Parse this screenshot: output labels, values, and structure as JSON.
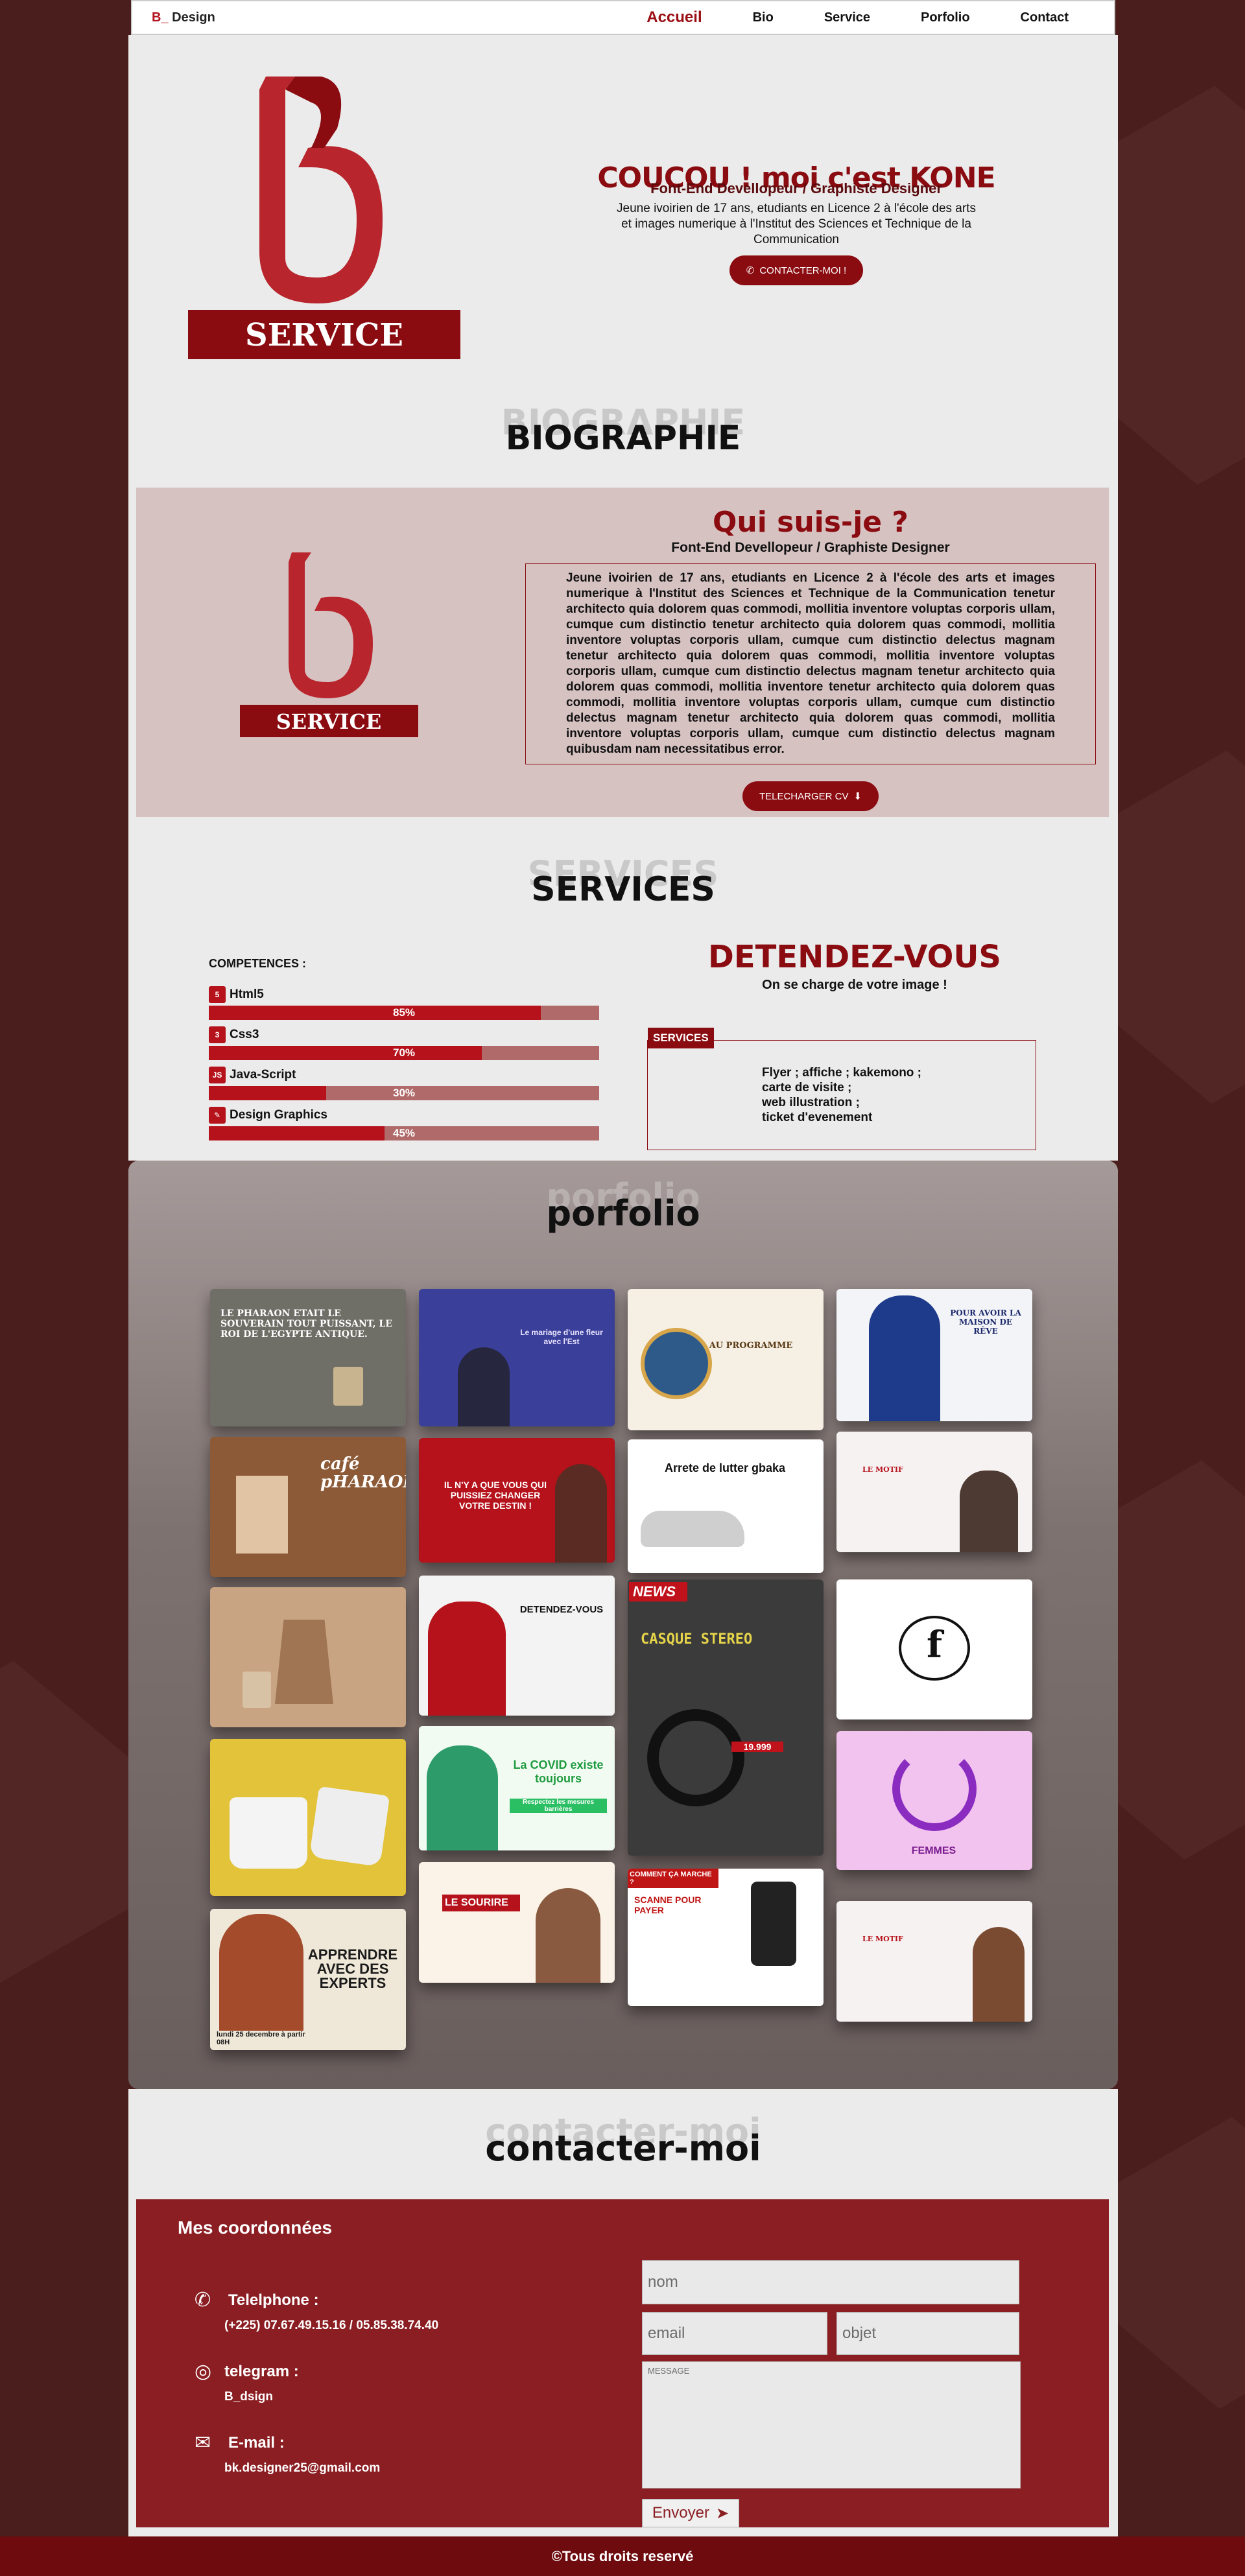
{
  "nav": {
    "brand_mark": "B_",
    "brand_text": "Design",
    "items": [
      {
        "label": "Accueil",
        "active": true
      },
      {
        "label": "Bio",
        "active": false
      },
      {
        "label": "Service",
        "active": false
      },
      {
        "label": "Porfolio",
        "active": false
      },
      {
        "label": "Contact",
        "active": false
      }
    ]
  },
  "hero": {
    "logo_letter": "B",
    "logo_word": "SERVICE",
    "title": "COUCOU ! moi c'est KONE",
    "subtitle": "Font-End Devellopeur / Graphiste Designer",
    "description": "Jeune ivoirien de 17 ans, etudiants en Licence 2 à l'école des arts et images numerique à l'Institut des Sciences et Technique de la Communication",
    "button": "CONTACTER-MOI !",
    "button_icon": "phone-icon"
  },
  "bio": {
    "ghost": "BIOGRAPHIE",
    "title": "BIOGRAPHIE",
    "heading": "Qui suis-je ?",
    "subtitle": "Font-End Devellopeur / Graphiste Designer",
    "text": "Jeune ivoirien de 17 ans, etudiants en Licence 2 à l'école des arts et images numerique à l'Institut des Sciences et Technique de la Communication tenetur architecto quia dolorem quas commodi, mollitia inventore voluptas corporis ullam, cumque cum distinctio tenetur architecto quia dolorem quas commodi, mollitia inventore voluptas corporis ullam, cumque cum distinctio delectus magnam tenetur architecto quia dolorem quas commodi, mollitia inventore voluptas corporis ullam, cumque cum distinctio delectus magnam tenetur architecto quia dolorem quas commodi, mollitia inventore tenetur architecto quia dolorem quas commodi, mollitia inventore voluptas corporis ullam, cumque cum distinctio delectus magnam tenetur architecto quia dolorem quas commodi, mollitia inventore voluptas corporis ullam, cumque cum distinctio delectus magnam quibusdam nam necessitatibus error.",
    "button": "TELECHARGER CV",
    "button_icon": "download-icon"
  },
  "services": {
    "ghost": "SERVICES",
    "title": "SERVICES",
    "competences_title": "COMPETENCES :",
    "skills": [
      {
        "name": "Html5",
        "icon": "html5-icon",
        "badge": "5",
        "percent": 85,
        "label": "85%"
      },
      {
        "name": "Css3",
        "icon": "css3-icon",
        "badge": "3",
        "percent": 70,
        "label": "70%"
      },
      {
        "name": "Java-Script",
        "icon": "js-icon",
        "badge": "JS",
        "percent": 30,
        "label": "30%"
      },
      {
        "name": "Design Graphics",
        "icon": "pen-icon",
        "badge": "✎",
        "percent": 45,
        "label": "45%"
      }
    ],
    "promo_title": "DETENDEZ-VOUS",
    "promo_sub": "On se charge de votre image !",
    "box_tag": "SERVICES",
    "offers": [
      "Flyer ; affiche ; kakemono ;",
      "carte de visite ;",
      "web illustration ;",
      "ticket d'evenement"
    ]
  },
  "portfolio": {
    "ghost": "porfolio",
    "title": "porfolio",
    "tiles": [
      {
        "caption": "LE PHARAON ETAIT LE SOUVERAIN TOUT PUISSANT, LE ROI DE L'EGYPTE ANTIQUE.",
        "bg": "#6f6e67",
        "fg": "#ffffff"
      },
      {
        "caption": "Le mariage d'une fleur avec l'Est",
        "bg": "#3a3f9a",
        "fg": "#e9e3ff"
      },
      {
        "caption": "AU PROGRAMME",
        "bg": "#f6f0e4",
        "fg": "#5b3b16"
      },
      {
        "caption": "POUR AVOIR LA MAISON DE RÊVE",
        "bg": "#f2f4f8",
        "fg": "#1d2a6b"
      },
      {
        "caption": "café pHARAON",
        "bg": "#8c5a36",
        "fg": "#ffffff"
      },
      {
        "caption": "IL N'Y A QUE VOUS QUI PUISSIEZ CHANGER VOTRE DESTIN !",
        "bg": "#b5121b",
        "fg": "#ffffff"
      },
      {
        "caption": "Arrete de lutter gbaka",
        "bg": "#ffffff",
        "fg": "#111111"
      },
      {
        "caption": "LE MOTIF",
        "bg": "#f7f2f2",
        "fg": "#b5121b"
      },
      {
        "caption": "",
        "bg": "#c9a482",
        "fg": "#ffffff"
      },
      {
        "caption": "DETENDEZ-VOUS",
        "bg": "#f3f3f3",
        "fg": "#111111"
      },
      {
        "caption": "CASQUE STEREO",
        "bg": "#3b3b3b",
        "fg": "#e6d44a"
      },
      {
        "caption": "f",
        "bg": "#ffffff",
        "fg": "#111111"
      },
      {
        "caption": "",
        "bg": "#e2c33a",
        "fg": "#ffffff"
      },
      {
        "caption": "La COVID existe toujours",
        "bg": "#f1fbf2",
        "fg": "#1f9b3f"
      },
      {
        "caption": "FEMMES",
        "bg": "#f2c3ef",
        "fg": "#7a1c8f"
      },
      {
        "caption": "APPRENDRE AVEC DES EXPERTS",
        "bg": "#efe8d8",
        "fg": "#1b1b1b"
      },
      {
        "caption": "LE SOURIRE",
        "bg": "#fbf3e7",
        "fg": "#b5121b"
      },
      {
        "caption": "SCANNE POUR PAYER",
        "bg": "#ffffff",
        "fg": "#c01515"
      },
      {
        "caption": "LE MOTIF",
        "bg": "#f7f2f2",
        "fg": "#b5121b"
      }
    ],
    "news_badge": "NEWS",
    "price": "19.999",
    "covid_sub": "Respectez les mesures barrières",
    "scan_header": "COMMENT ÇA MARCHE ?",
    "apprendre_date": "lundi 25 decembre à partir 08H"
  },
  "contact": {
    "ghost": "contacter-moi",
    "title": "contacter-moi",
    "coords_title": "Mes coordonnées",
    "phone_label": "Telelphone :",
    "phone_value": "(+225) 07.67.49.15.16 / 05.85.38.74.40",
    "telegram_label": "telegram :",
    "telegram_value": "B_dsign",
    "email_label": "E-mail :",
    "email_value": "bk.designer25@gmail.com",
    "name_placeholder": "nom",
    "email_placeholder": "email",
    "subject_placeholder": "objet",
    "message_placeholder": "MESSAGE",
    "send_label": "Envoyer"
  },
  "footer": {
    "text": "©Tous droits reservé"
  }
}
